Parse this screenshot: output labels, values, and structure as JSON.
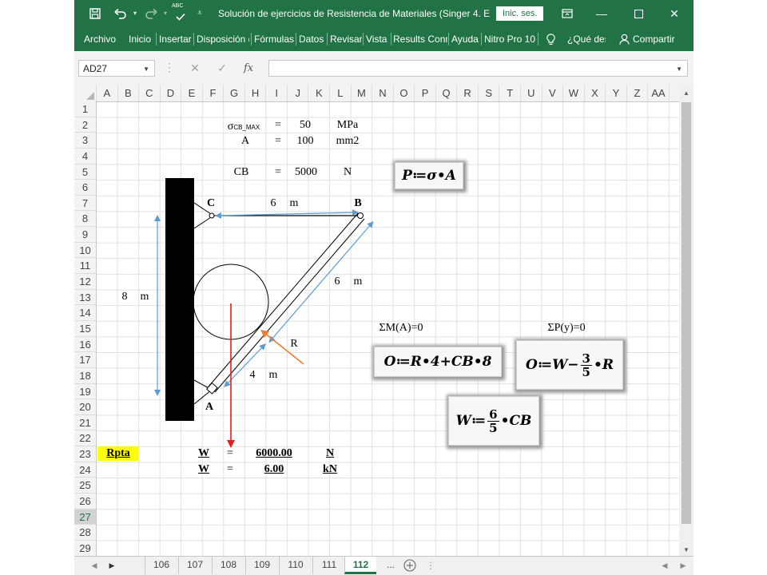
{
  "titlebar": {
    "title": "Solución de ejercicios de Resistencia de Materiales (Singer 4. E...",
    "sign_in": "Inic. ses.",
    "spelling_badge": "ABC"
  },
  "ribbon": {
    "tabs": [
      "Archivo",
      "Inicio",
      "Insertar",
      "Disposición d",
      "Fórmulas",
      "Datos",
      "Revisar",
      "Vista",
      "Results Conn",
      "Ayuda",
      "Nitro Pro 10"
    ],
    "tell_me": "¿Qué desea hacer?",
    "share": "Compartir"
  },
  "formula_bar": {
    "name_box": "AD27",
    "formula": "",
    "fx": "fx"
  },
  "columns": [
    "A",
    "B",
    "C",
    "D",
    "E",
    "F",
    "G",
    "H",
    "I",
    "J",
    "K",
    "L",
    "M",
    "N",
    "O",
    "P",
    "Q",
    "R",
    "S",
    "T",
    "U",
    "V",
    "W",
    "X",
    "Y",
    "Z",
    "AA"
  ],
  "rows": [
    "1",
    "2",
    "3",
    "4",
    "5",
    "6",
    "7",
    "8",
    "9",
    "10",
    "11",
    "12",
    "13",
    "14",
    "15",
    "16",
    "17",
    "18",
    "19",
    "20",
    "21",
    "22",
    "23",
    "24",
    "25",
    "26",
    "27",
    "28",
    "29"
  ],
  "selected_row": "27",
  "sheet": {
    "sigma_label": "σ",
    "sigma_sub": "CB_MAX",
    "eq": "=",
    "sigma_value": "50",
    "sigma_unit": "MPa",
    "area_label": "A",
    "area_value": "100",
    "area_unit": "mm2",
    "cb_label": "CB",
    "cb_value": "5000",
    "cb_unit": "N",
    "height_value": "8",
    "height_unit": "m",
    "cb_len_value": "6",
    "cb_len_unit": "m",
    "ab_len_value": "6",
    "ab_len_unit": "m",
    "ar_len_value": "4",
    "ar_len_unit": "m",
    "point_c": "C",
    "point_b": "B",
    "point_a": "A",
    "point_r": "R",
    "sum_moment": "ΣM(A)=0",
    "sum_force": "ΣP(y)=0",
    "rpta": "Rpta",
    "w_label": "W",
    "w_value_n": "6000.00",
    "w_unit_n": "N",
    "w_value_kn": "6.00",
    "w_unit_kn": "kN"
  },
  "equations": {
    "stress": "P≔σ•A",
    "moment": "O≔R•4+CB•8",
    "force_prefix": "O≔W−",
    "force_num": "3",
    "force_den": "5",
    "force_suffix": "•R",
    "weight_prefix": "W≔",
    "weight_num": "6",
    "weight_den": "5",
    "weight_suffix": "•CB"
  },
  "sheet_tabs": [
    "106",
    "107",
    "108",
    "109",
    "110",
    "111",
    "112"
  ],
  "active_sheet": "112",
  "more_tabs": "...",
  "colors": {
    "excel_green": "#217346",
    "load_arrow": "#e81b1b",
    "dim_arrow": "#5b9bd5",
    "reaction_arrow": "#ed7d31",
    "highlight": "#ffff00"
  }
}
